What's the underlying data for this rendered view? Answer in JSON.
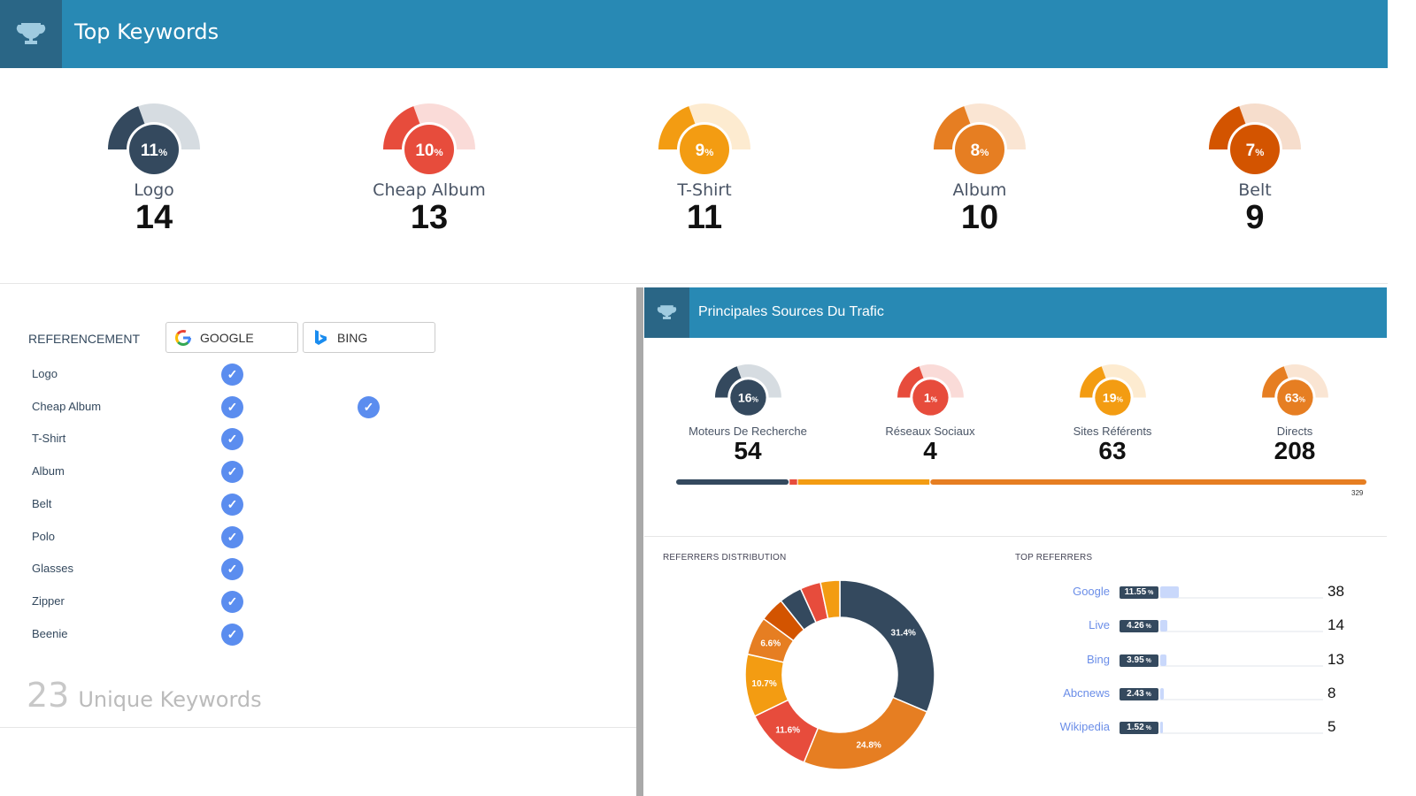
{
  "header": {
    "title": "Top Keywords",
    "icon": "trophy-icon"
  },
  "keywords_top": [
    {
      "label": "Logo",
      "count": "14",
      "percent": "11",
      "color": "#34495e",
      "light": "#d6dce1"
    },
    {
      "label": "Cheap Album",
      "count": "13",
      "percent": "10",
      "color": "#e74c3c",
      "light": "#fadbd8"
    },
    {
      "label": "T-Shirt",
      "count": "11",
      "percent": "9",
      "color": "#f39c12",
      "light": "#fdebd0"
    },
    {
      "label": "Album",
      "count": "10",
      "percent": "8",
      "color": "#e67e22",
      "light": "#fae5d3"
    },
    {
      "label": "Belt",
      "count": "9",
      "percent": "7",
      "color": "#d35400",
      "light": "#f6ddcc"
    }
  ],
  "referencement": {
    "label": "REFERENCEMENT",
    "engines": [
      {
        "name": "GOOGLE",
        "icon": "google-icon"
      },
      {
        "name": "BING",
        "icon": "bing-icon"
      }
    ],
    "keywords": [
      {
        "name": "Logo",
        "google": true,
        "bing": false
      },
      {
        "name": "Cheap Album",
        "google": true,
        "bing": true
      },
      {
        "name": "T-Shirt",
        "google": true,
        "bing": false
      },
      {
        "name": "Album",
        "google": true,
        "bing": false
      },
      {
        "name": "Belt",
        "google": true,
        "bing": false
      },
      {
        "name": "Polo",
        "google": true,
        "bing": false
      },
      {
        "name": "Glasses",
        "google": true,
        "bing": false
      },
      {
        "name": "Zipper",
        "google": true,
        "bing": false
      },
      {
        "name": "Beenie",
        "google": true,
        "bing": false
      }
    ],
    "unique_count": "23",
    "unique_label": "Unique Keywords"
  },
  "traffic": {
    "title": "Principales Sources Du Trafic",
    "sources": [
      {
        "label": "Moteurs De Recherche",
        "count": "54",
        "percent": "16",
        "color": "#34495e",
        "light": "#d6dce1"
      },
      {
        "label": "Réseaux Sociaux",
        "count": "4",
        "percent": "1",
        "color": "#e74c3c",
        "light": "#fadbd8"
      },
      {
        "label": "Sites Référents",
        "count": "63",
        "percent": "19",
        "color": "#f39c12",
        "light": "#fdebd0"
      },
      {
        "label": "Directs",
        "count": "208",
        "percent": "63",
        "color": "#e67e22",
        "light": "#fae5d3"
      }
    ],
    "total": "329"
  },
  "referrers_distribution": {
    "title": "REFERRERS DISTRIBUTION",
    "chart_data": {
      "type": "pie",
      "values": [
        31.4,
        24.8,
        11.6,
        10.7,
        6.6,
        4.2,
        3.9,
        3.5,
        3.3
      ],
      "labels": [
        "31.4%",
        "24.8%",
        "11.6%",
        "10.7%",
        "6.6%",
        "",
        "",
        "",
        ""
      ],
      "colors": [
        "#34495e",
        "#e67e22",
        "#e74c3c",
        "#f39c12",
        "#e67e22",
        "#d35400",
        "#34495e",
        "#e74c3c",
        "#f39c12"
      ]
    }
  },
  "top_referrers": {
    "title": "TOP REFERRERS",
    "items": [
      {
        "name": "Google",
        "percent": "11.55",
        "count": "38"
      },
      {
        "name": "Live",
        "percent": "4.26",
        "count": "14"
      },
      {
        "name": "Bing",
        "percent": "3.95",
        "count": "13"
      },
      {
        "name": "Abcnews",
        "percent": "2.43",
        "count": "8"
      },
      {
        "name": "Wikipedia",
        "percent": "1.52",
        "count": "5"
      }
    ]
  }
}
